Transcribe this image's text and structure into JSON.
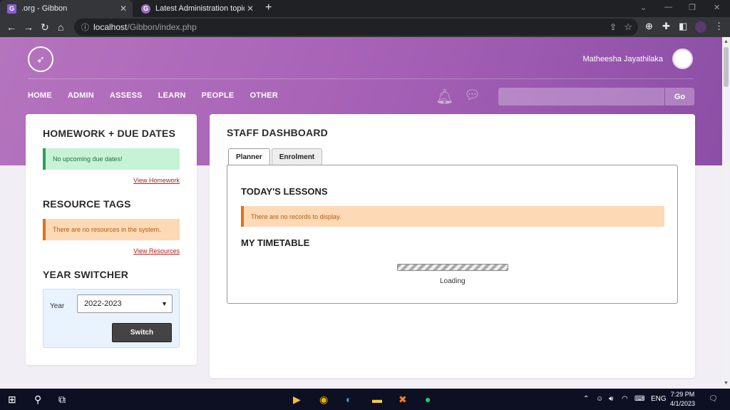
{
  "browser": {
    "tabs": [
      {
        "favicon": "G",
        "label": ".org - Gibbon"
      },
      {
        "favicon": "G",
        "label": "Latest Administration topics - Gib"
      }
    ],
    "url_host": "localhost",
    "url_path": "/Gibbon/index.php"
  },
  "header": {
    "user_name": "Matheesha Jayathilaka",
    "nav": [
      "HOME",
      "ADMIN",
      "ASSESS",
      "LEARN",
      "PEOPLE",
      "OTHER"
    ],
    "go_label": "Go"
  },
  "sidebar": {
    "homework_title": "HOMEWORK + DUE DATES",
    "homework_alert": "No upcoming due dates!",
    "homework_link": "View Homework",
    "resources_title": "RESOURCE TAGS",
    "resources_alert": "There are no resources in the system.",
    "resources_link": "View Resources",
    "year_title": "YEAR SWITCHER",
    "year_label": "Year",
    "year_value": "2022-2023",
    "switch_label": "Switch"
  },
  "main": {
    "title": "STAFF DASHBOARD",
    "tabs": [
      "Planner",
      "Enrolment"
    ],
    "lessons_title": "TODAY'S LESSONS",
    "lessons_alert": "There are no records to display.",
    "timetable_title": "MY TIMETABLE",
    "loading_text": "Loading"
  },
  "taskbar": {
    "lang": "ENG",
    "time": "7:29 PM",
    "date": "4/1/2023"
  },
  "colors": {
    "hero_start": "#b574be",
    "hero_end": "#8c4ea6",
    "success": "#2e9e59",
    "warning": "#e0701e"
  }
}
